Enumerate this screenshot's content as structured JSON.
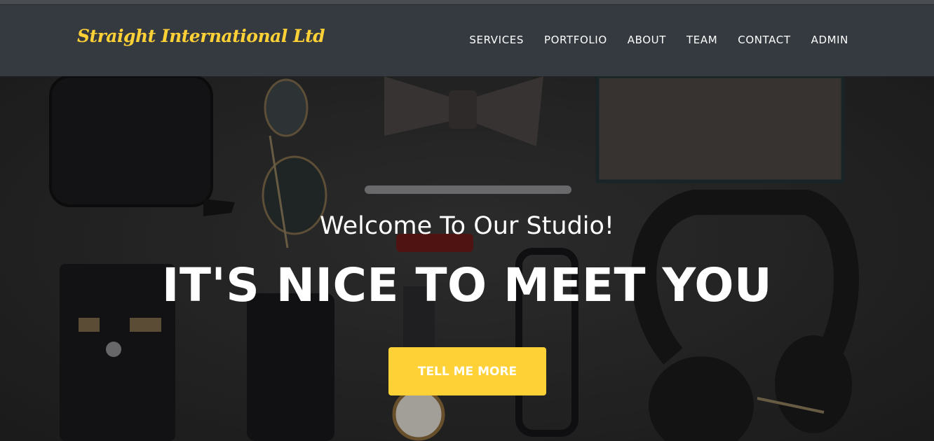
{
  "brand": {
    "name": "Straight International Ltd"
  },
  "nav": {
    "items": [
      {
        "label": "SERVICES"
      },
      {
        "label": "PORTFOLIO"
      },
      {
        "label": "ABOUT"
      },
      {
        "label": "TEAM"
      },
      {
        "label": "CONTACT"
      },
      {
        "label": "ADMIN"
      }
    ]
  },
  "hero": {
    "lead_in": "Welcome To Our Studio!",
    "heading": "IT'S NICE TO MEET YOU",
    "cta_label": "TELL ME MORE"
  },
  "colors": {
    "navbar_bg": "#343a40",
    "accent": "#fed136",
    "text": "#ffffff"
  }
}
